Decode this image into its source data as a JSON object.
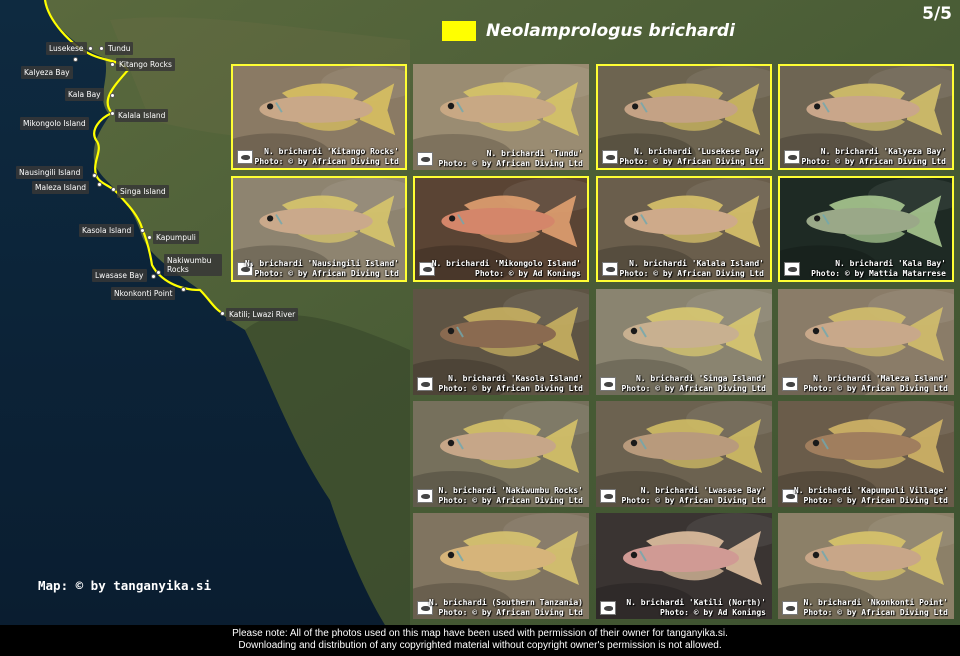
{
  "page_number": "5/5",
  "legend": {
    "title": "Neolamprologus brichardi",
    "color": "#ffff00"
  },
  "map_credit": "Map: © by tanganyika.si",
  "footer": {
    "line1": "Please note: All of the photos used on this map have been used with permission of their owner for tanganyika.si.",
    "line2": "Downloading and distribution of any copyrighted material without copyright owner's permission is not allowed."
  },
  "locations": [
    "Lusekese",
    "Tundu",
    "Kitango Rocks",
    "Kalyeza Bay",
    "Kala Bay",
    "Kalala Island",
    "Mikongolo Island",
    "Nausingili Island",
    "Maleza Island",
    "Singa Island",
    "Kasola Island",
    "Kapumpuli",
    "Nakiwumbu Rocks",
    "Lwasase Bay",
    "Nkonkonti Point",
    "Katili; Lwazi River"
  ],
  "photos": [
    {
      "label": "N. brichardi 'Kitango Rocks'",
      "credit": "Photo: © by African Diving Ltd",
      "highlighted": true,
      "bg": "#8a7a64",
      "fish": "#c9a888",
      "fin": "#d8c060"
    },
    {
      "label": "N. brichardi 'Tundu'",
      "credit": "Photo: © by African Diving Ltd",
      "highlighted": false,
      "bg": "#9a8c72",
      "fish": "#c8a884",
      "fin": "#d7c468"
    },
    {
      "label": "N. brichardi 'Lusekese Bay'",
      "credit": "Photo: © by African Diving Ltd",
      "highlighted": true,
      "bg": "#6d6450",
      "fish": "#c4a285",
      "fin": "#cdb860"
    },
    {
      "label": "N. brichardi 'Kalyeza Bay'",
      "credit": "Photo: © by African Diving Ltd",
      "highlighted": true,
      "bg": "#6e6553",
      "fish": "#c9a68a",
      "fin": "#d3c06a"
    },
    {
      "label": "N. brichardi 'Nausingili Island'",
      "credit": "Photo: © by African Diving Ltd",
      "highlighted": true,
      "bg": "#8e8470",
      "fish": "#caa98b",
      "fin": "#d7c56c"
    },
    {
      "label": "N. brichardi 'Mikongolo Island'",
      "credit": "Photo: © by Ad Konings",
      "highlighted": true,
      "bg": "#5a4434",
      "fish": "#d4866a",
      "fin": "#e0a070"
    },
    {
      "label": "N. brichardi 'Kalala Island'",
      "credit": "Photo: © by African Diving Ltd",
      "highlighted": true,
      "bg": "#6a5e4c",
      "fish": "#ceaa8a",
      "fin": "#d8c26a"
    },
    {
      "label": "N. brichardi 'Kala Bay'",
      "credit": "Photo: © by Mattia Matarrese",
      "highlighted": true,
      "bg": "#1e2a24",
      "fish": "#9aa888",
      "fin": "#a8c890"
    },
    {
      "label": "N. brichardi 'Kasola Island'",
      "credit": "Photo: © by African Diving Ltd",
      "highlighted": false,
      "bg": "#5e5444",
      "fish": "#8a6a50",
      "fin": "#c8b060"
    },
    {
      "label": "N. brichardi 'Singa Island'",
      "credit": "Photo: © by African Diving Ltd",
      "highlighted": false,
      "bg": "#8a8470",
      "fish": "#c8b090",
      "fin": "#d8c870"
    },
    {
      "label": "N. brichardi 'Maleza Island'",
      "credit": "Photo: © by African Diving Ltd",
      "highlighted": false,
      "bg": "#8a7c68",
      "fish": "#c8a88a",
      "fin": "#d2be6c"
    },
    {
      "label": "N. brichardi 'Nakiwumbu Rocks'",
      "credit": "Photo: © by African Diving Ltd",
      "highlighted": false,
      "bg": "#76705c",
      "fish": "#c6a688",
      "fin": "#d6c268"
    },
    {
      "label": "N. brichardi 'Lwasase Bay'",
      "credit": "Photo: © by African Diving Ltd",
      "highlighted": false,
      "bg": "#6c6250",
      "fish": "#b89a7c",
      "fin": "#d0bc64"
    },
    {
      "label": "N. brichardi 'Kapumpuli Village'",
      "credit": "Photo: © by African Diving Ltd",
      "highlighted": false,
      "bg": "#6a5c4a",
      "fish": "#a07e5e",
      "fin": "#d0b466"
    },
    {
      "label": "N. brichardi (Southern Tanzania)",
      "credit": "Photo: © by African Diving Ltd",
      "highlighted": false,
      "bg": "#807460",
      "fish": "#d6b47a",
      "fin": "#d8c470"
    },
    {
      "label": "N. brichardi 'Katili (North)'",
      "credit": "Photo: © by Ad Konings",
      "highlighted": false,
      "bg": "#3a3432",
      "fish": "#d09a94",
      "fin": "#e0c0a0"
    },
    {
      "label": "N. brichardi 'Nkonkonti Point'",
      "credit": "Photo: © by African Diving Ltd",
      "highlighted": false,
      "bg": "#8c8068",
      "fish": "#c8a688",
      "fin": "#d8c46a"
    }
  ]
}
